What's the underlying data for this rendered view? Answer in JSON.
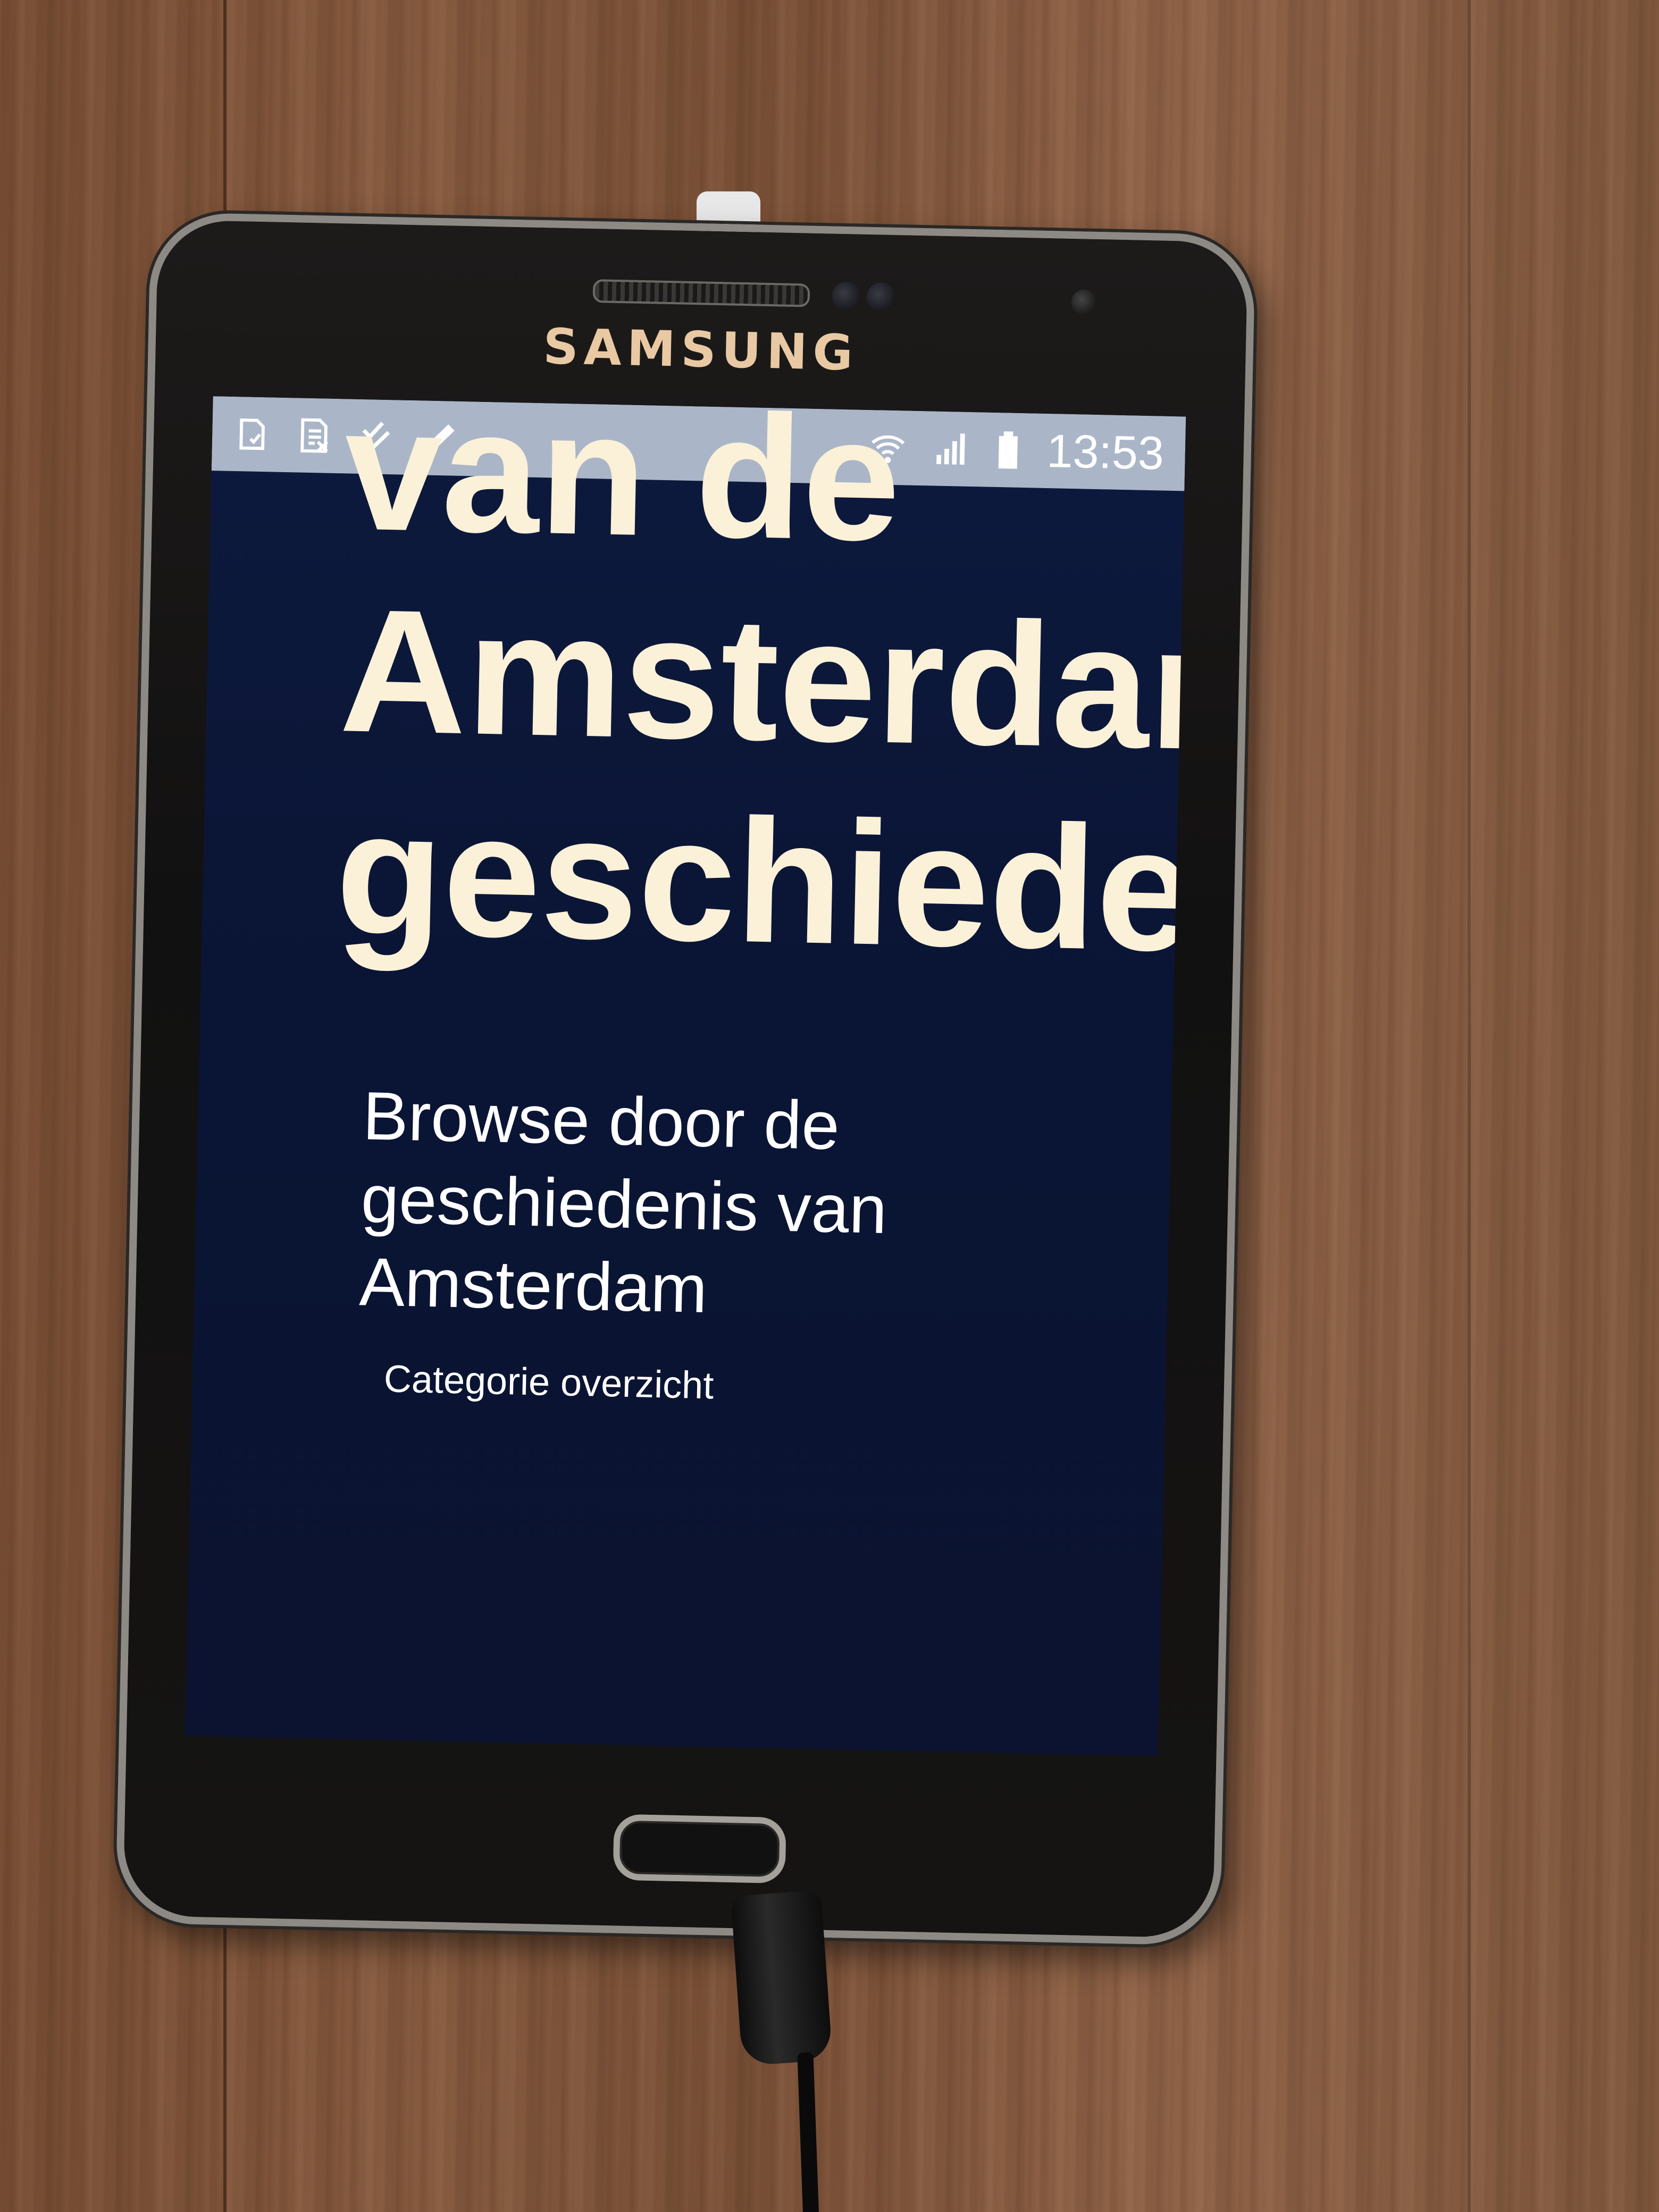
{
  "device": {
    "brand": "SAMSUNG"
  },
  "status_bar": {
    "left_icons": [
      "sd-card-icon",
      "excel-file-icon",
      "check-tasks-icon",
      "pencil-icon"
    ],
    "right_icons": [
      "wifi-icon",
      "signal-icon",
      "battery-icon"
    ],
    "time": "13:53"
  },
  "screen": {
    "headline_lines": [
      "van de",
      "Amsterdam",
      "geschieden"
    ],
    "subtitle_lines": [
      "Browse door de",
      "geschiedenis van",
      "Amsterdam"
    ],
    "category_link": "Categorie overzicht"
  },
  "colors": {
    "screen_background": "#0b1634",
    "headline_text": "#fbf1d8",
    "status_bar": "#aab6c8",
    "logo_gold": "#e9c9a3"
  }
}
